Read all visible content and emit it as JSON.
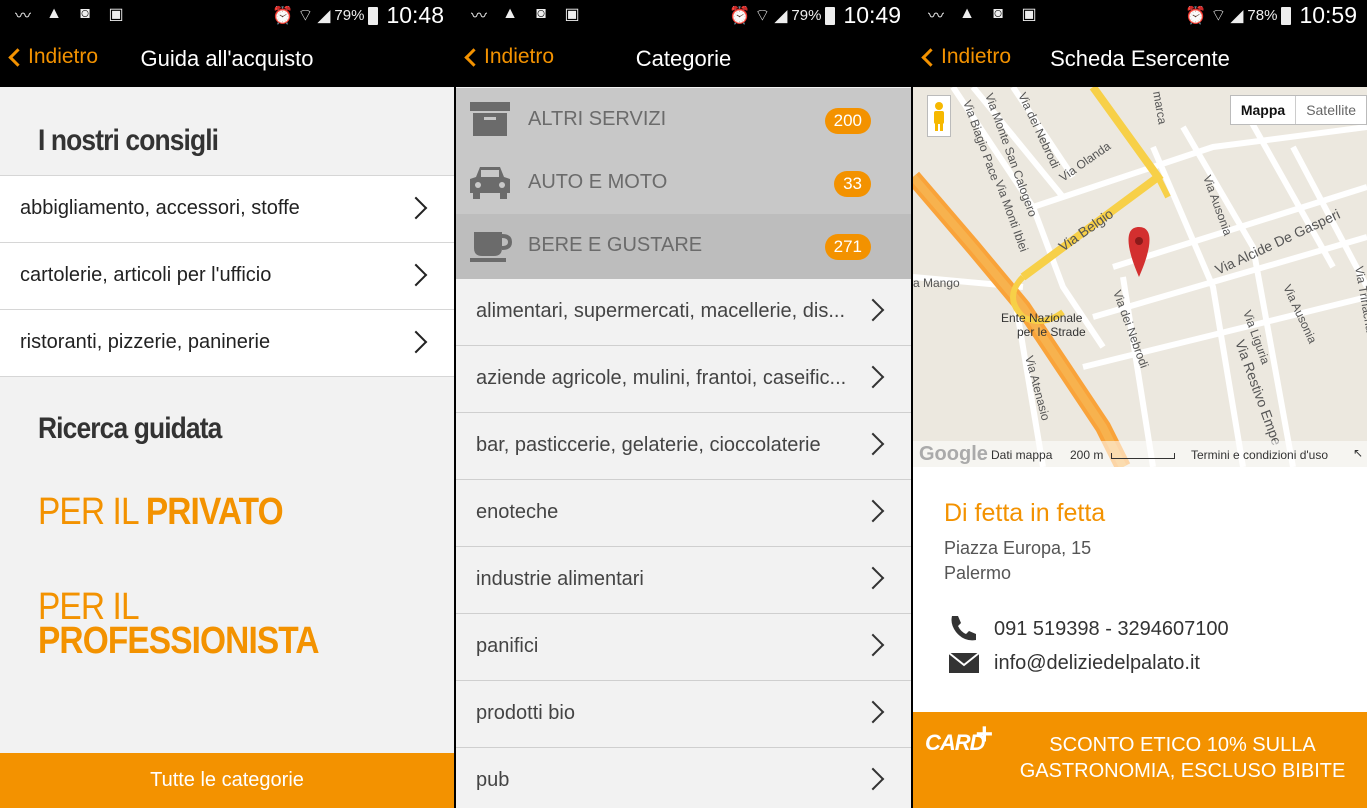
{
  "panel1": {
    "status": {
      "battery": "79%",
      "time": "10:48"
    },
    "back_label": "Indietro",
    "title": "Guida all'acquisto",
    "section1_title": "I nostri consigli",
    "items": [
      {
        "label": "abbigliamento, accessori, stoffe"
      },
      {
        "label": "cartolerie, articoli per l'ufficio"
      },
      {
        "label": "ristoranti, pizzerie, paninerie"
      }
    ],
    "section2_title": "Ricerca guidata",
    "private_prefix": "PER IL",
    "private_bold": "PRIVATO",
    "pro_prefix": "PER IL",
    "pro_bold": "PROFESSIONISTA",
    "bottom_button": "Tutte le categorie"
  },
  "panel2": {
    "status": {
      "battery": "79%",
      "time": "10:49"
    },
    "back_label": "Indietro",
    "title": "Categorie",
    "categories": [
      {
        "label": "ALTRI SERVIZI",
        "count": "200",
        "icon": "archive-box-icon"
      },
      {
        "label": "AUTO E MOTO",
        "count": "33",
        "icon": "car-icon"
      },
      {
        "label": "BERE E GUSTARE",
        "count": "271",
        "icon": "coffee-cup-icon"
      }
    ],
    "items": [
      {
        "label": "alimentari, supermercati, macellerie, dis..."
      },
      {
        "label": "aziende agricole, mulini, frantoi, caseific..."
      },
      {
        "label": "bar, pasticcerie, gelaterie, cioccolaterie"
      },
      {
        "label": "enoteche"
      },
      {
        "label": "industrie alimentari"
      },
      {
        "label": "panifici"
      },
      {
        "label": "prodotti bio"
      },
      {
        "label": "pub"
      }
    ]
  },
  "panel3": {
    "status": {
      "battery": "78%",
      "time": "10:59"
    },
    "back_label": "Indietro",
    "title": "Scheda Esercente",
    "map": {
      "toggle_map": "Mappa",
      "toggle_satellite": "Satellite",
      "footer_data": "Dati mappa",
      "footer_scale": "200 m",
      "footer_terms": "Termini e condizioni d'uso",
      "google": "Google",
      "labels": {
        "via_belgio": "Via Belgio",
        "via_de_gasperi": "Via Alcide De Gasperi",
        "ente": "Ente Nazionale",
        "ente2": "per le Strade",
        "mango": "a Mango",
        "via_nebrodi": "Via dei Nebrodi",
        "via_nebrodi2": "Via dei Nebrodi",
        "via_olanda": "Via Olanda",
        "via_ausonia": "Via Ausonia",
        "via_ausonia2": "Via Ausonia",
        "via_liguria": "Via Liguria",
        "via_restivo": "Via Restivo Empe",
        "via_monti": "Via Monti Iblei",
        "via_biagio": "Via Biagio Pace",
        "via_monte_sc": "Via Monte San Calogero",
        "via_atenasio": "Via Atenasio",
        "via_trinacria": "Via Trinacria",
        "marca": "marca"
      }
    },
    "merchant_name": "Di fetta in fetta",
    "address_line1": "Piazza Europa, 15",
    "address_line2": "Palermo",
    "phone": "091 519398 - 3294607100",
    "email": "info@deliziedelpalato.it",
    "card_logo": "CARD",
    "card_text": "SCONTO ETICO 10% SULLA GASTRONOMIA, ESCLUSO BIBITE"
  },
  "colors": {
    "accent": "#f39200",
    "bar": "#000000"
  }
}
